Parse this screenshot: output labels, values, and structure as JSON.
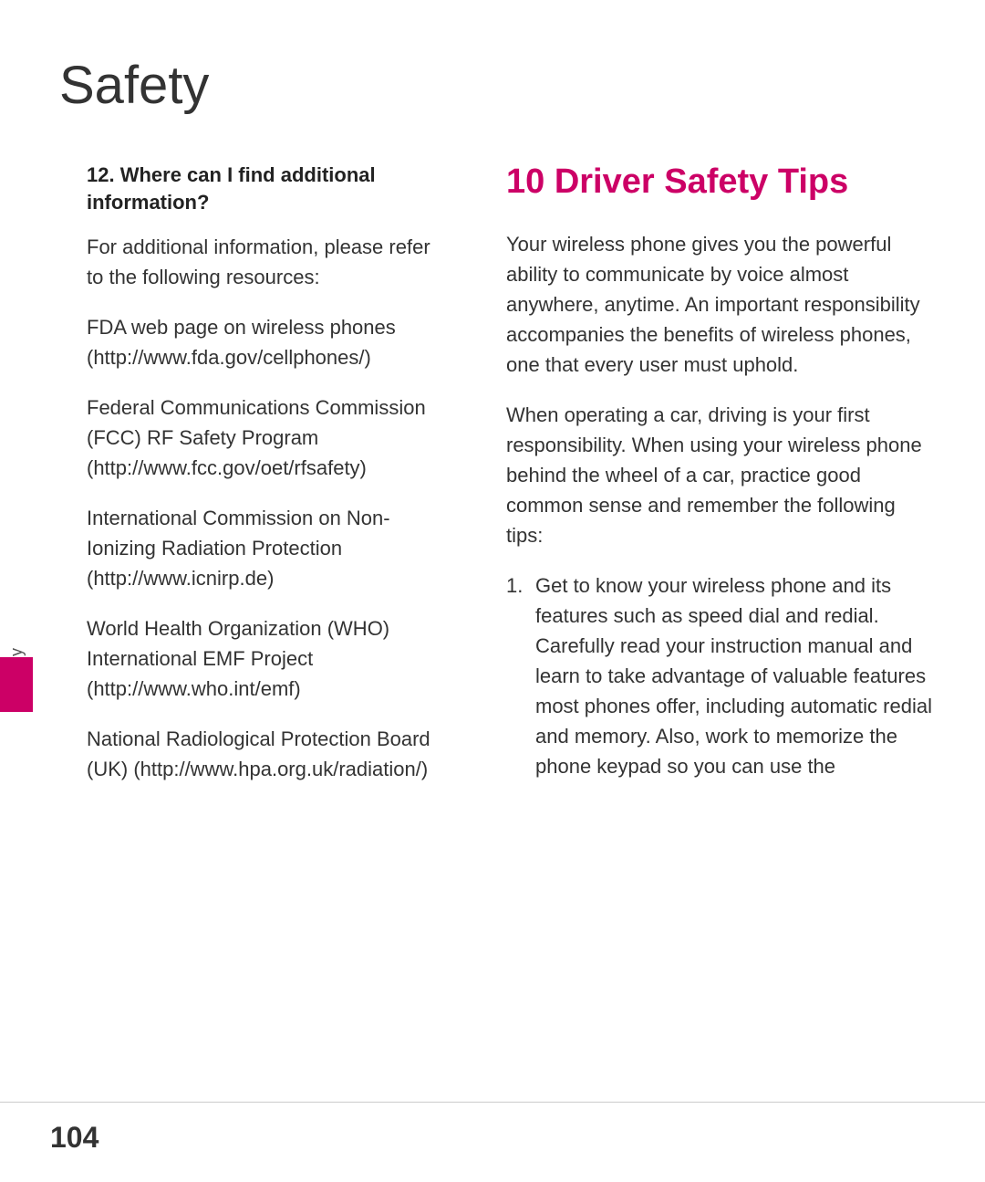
{
  "page": {
    "title": "Safety",
    "page_number": "104"
  },
  "side_tab": {
    "label": "Safety"
  },
  "left_column": {
    "question_heading": "12. Where can I find additional information?",
    "intro_text": "For additional information, please refer to the following resources:",
    "resources": [
      {
        "text": "FDA web page on wireless phones (http://www.fda.gov/cellphones/)"
      },
      {
        "text": "Federal Communications Commission (FCC) RF Safety Program (http://www.fcc.gov/oet/rfsafety)"
      },
      {
        "text": "International Commission on Non-Ionizing Radiation Protection (http://www.icnirp.de)"
      },
      {
        "text": "World Health Organization (WHO) International EMF Project (http://www.who.int/emf)"
      },
      {
        "text": "National Radiological Protection Board (UK) (http://www.hpa.org.uk/radiation/)"
      }
    ]
  },
  "right_column": {
    "heading": "10 Driver Safety Tips",
    "paragraphs": [
      "Your wireless phone gives you the powerful ability to communicate by voice almost anywhere, anytime. An important responsibility accompanies the benefits of wireless phones, one that every user must uphold.",
      "When operating a car, driving is your first responsibility. When using your wireless phone behind the wheel of a car, practice good common sense and remember the following tips:"
    ],
    "tips": [
      {
        "number": "1.",
        "text": "Get to know your wireless phone and its features such as speed dial and redial. Carefully read your instruction manual and learn to take advantage of valuable features most phones offer, including automatic redial and memory. Also, work to memorize the phone keypad so you can use the"
      }
    ]
  }
}
